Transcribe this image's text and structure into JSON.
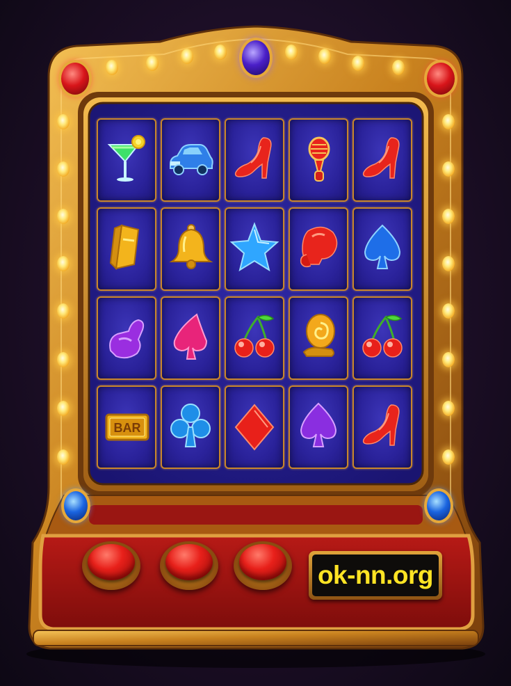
{
  "machine": {
    "display_text": "ok-nn.org",
    "colors": {
      "gold": "#d9962e",
      "reel_bg": "#2a229a",
      "button_red": "#e8201a",
      "display_text": "#ffe424"
    }
  },
  "reels": [
    [
      "cocktail-icon",
      "car-icon",
      "high-heel-icon",
      "microphone-icon",
      "high-heel-icon"
    ],
    [
      "gold-bar-icon",
      "bell-icon",
      "star-icon",
      "boxing-glove-icon",
      "spade-icon"
    ],
    [
      "flexed-arm-icon",
      "pink-spade-icon",
      "cherries-icon",
      "gold-snail-icon",
      "cherries-icon"
    ],
    [
      "bar-icon",
      "club-icon",
      "diamond-icon",
      "purple-spade-icon",
      "high-heel-icon"
    ]
  ],
  "bar_symbol_label": "BAR",
  "spin_buttons": [
    "button-1",
    "button-2",
    "button-3"
  ]
}
